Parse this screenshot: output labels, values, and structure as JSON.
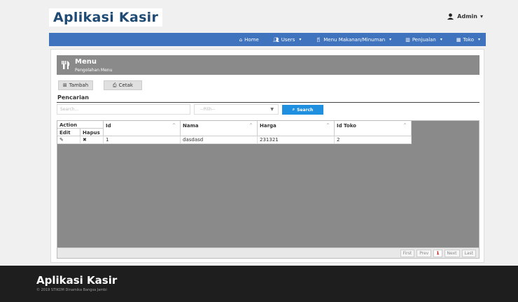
{
  "header": {
    "brand": "Aplikasi Kasir",
    "user": "Admin"
  },
  "nav": [
    {
      "label": "Home",
      "icon": "home-icon",
      "dropdown": false
    },
    {
      "label": "Users",
      "icon": "users-icon",
      "dropdown": true
    },
    {
      "label": "Menu Makanan/Minuman",
      "icon": "cutlery-icon",
      "dropdown": true
    },
    {
      "label": "Penjualan",
      "icon": "chart-icon",
      "dropdown": true
    },
    {
      "label": "Toko",
      "icon": "grid-icon",
      "dropdown": true
    }
  ],
  "panel": {
    "title": "Menu",
    "subtitle": "Pengolahan Menu",
    "buttons": {
      "tambah": "Tambah",
      "cetak": "Cetak"
    },
    "search": {
      "label": "Pencarian",
      "placeholder": "Search...",
      "select": "--Pilih--",
      "button": "Search"
    }
  },
  "table": {
    "headers": {
      "action": "Action",
      "edit": "Edit",
      "hapus": "Hapus",
      "id": "Id",
      "nama": "Nama",
      "harga": "Harga",
      "id_toko": "Id Toko"
    },
    "rows": [
      {
        "hapus": "✖",
        "id": "1",
        "nama": "dasdasd",
        "harga": "231321",
        "id_toko": "2"
      }
    ],
    "pager": {
      "first": "First",
      "prev": "Prev",
      "page": "1",
      "next": "Next",
      "last": "Last"
    }
  },
  "footer": {
    "brand": "Aplikasi Kasir",
    "copyright": "© 2019 STIKOM Dinamika Bangsa Jambi"
  }
}
